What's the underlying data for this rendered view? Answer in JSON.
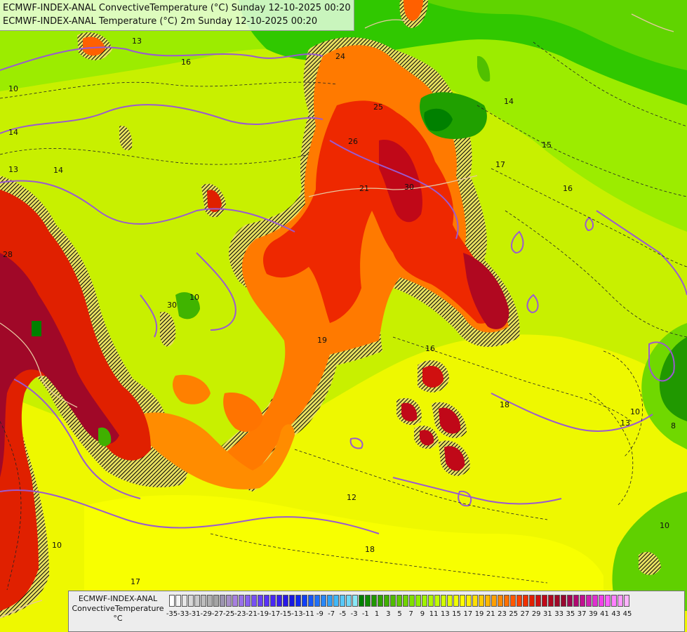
{
  "header": {
    "line1": "ECMWF-INDEX-ANAL ConvectiveTemperature (°C) Sunday 12-10-2025 00:20",
    "line2": "ECMWF-INDEX-ANAL Temperature (°C) 2m Sunday 12-10-2025 00:20"
  },
  "legend": {
    "label_line1": "ECMWF-INDEX-ANAL",
    "label_line2": "ConvectiveTemperature",
    "label_line3": "°C",
    "ticks": [
      "-35",
      "-33",
      "-31",
      "-29",
      "-27",
      "-25",
      "-23",
      "-21",
      "-19",
      "-17",
      "-15",
      "-13",
      "-11",
      "-9",
      "-7",
      "-5",
      "-3",
      "-1",
      "1",
      "3",
      "5",
      "7",
      "9",
      "11",
      "13",
      "15",
      "17",
      "19",
      "21",
      "23",
      "25",
      "27",
      "29",
      "31",
      "33",
      "35",
      "37",
      "39",
      "41",
      "43",
      "45"
    ],
    "colors": [
      "#ffffff",
      "#f4f4f4",
      "#e6e6e6",
      "#d8d8d8",
      "#cacaca",
      "#bcbcbc",
      "#b0b0b0",
      "#a4a4a4",
      "#9c94b0",
      "#a890c8",
      "#a880e0",
      "#9870e8",
      "#8860f0",
      "#7850f4",
      "#6840f8",
      "#5830f8",
      "#4828f4",
      "#3820f0",
      "#2818e8",
      "#1818e0",
      "#1028f0",
      "#1040f8",
      "#1858f8",
      "#2070f8",
      "#2888f8",
      "#30a0f8",
      "#40b8f8",
      "#58c8f8",
      "#70d8f8",
      "#88e8f8",
      "#008000",
      "#108c00",
      "#209800",
      "#30a400",
      "#40b000",
      "#50bc00",
      "#60c800",
      "#70d400",
      "#80e000",
      "#90ec00",
      "#a0f400",
      "#b0f800",
      "#c0fc00",
      "#d0ff00",
      "#e0ff00",
      "#f0ff00",
      "#ffff00",
      "#fff000",
      "#ffe000",
      "#ffcc00",
      "#ffb800",
      "#ffa000",
      "#ff8800",
      "#ff7000",
      "#ff5800",
      "#ff4000",
      "#f03000",
      "#e02000",
      "#d01010",
      "#c00818",
      "#b00820",
      "#a00828",
      "#980830",
      "#a00850",
      "#b00870",
      "#c01090",
      "#d020b0",
      "#e030d0",
      "#f040e8",
      "#ff60ff",
      "#ff80ff",
      "#ff99ff",
      "#ffb3ff"
    ]
  },
  "map_labels": [
    "13",
    "16",
    "10",
    "14",
    "13",
    "14",
    "24",
    "25",
    "26",
    "30",
    "21",
    "14",
    "15",
    "17",
    "16",
    "28",
    "10",
    "30",
    "16",
    "18",
    "19",
    "10",
    "13",
    "8",
    "10",
    "10",
    "17",
    "18",
    "12"
  ]
}
